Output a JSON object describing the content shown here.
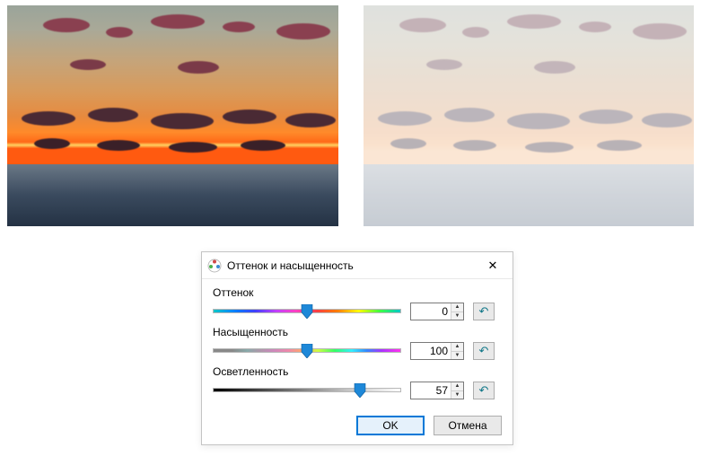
{
  "dialog": {
    "title": "Оттенок и насыщенность",
    "hue": {
      "label": "Оттенок",
      "value": 0,
      "min": -180,
      "max": 180,
      "thumb_pct": 50
    },
    "saturation": {
      "label": "Насыщенность",
      "value": 100,
      "min": 0,
      "max": 200,
      "thumb_pct": 50
    },
    "lightness": {
      "label": "Осветленность",
      "value": 57,
      "min": -100,
      "max": 100,
      "thumb_pct": 78
    },
    "buttons": {
      "ok": "OK",
      "cancel": "Отмена"
    },
    "icons": {
      "close": "✕",
      "reset": "↶",
      "spin_up": "▲",
      "spin_down": "▼"
    }
  }
}
